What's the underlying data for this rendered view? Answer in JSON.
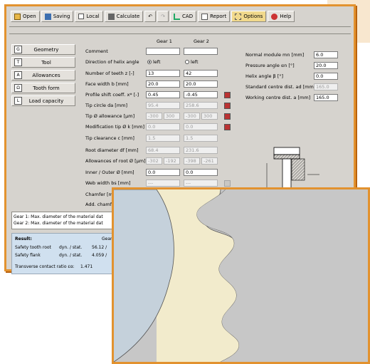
{
  "toolbar": {
    "open": "Open",
    "saving": "Saving",
    "local": "Local",
    "calculate": "Calculate",
    "cad": "CAD",
    "report": "Report",
    "options": "Options",
    "help": "Help"
  },
  "sidebar": [
    {
      "label": "Geometry",
      "icon": "G"
    },
    {
      "label": "Tool",
      "icon": "T"
    },
    {
      "label": "Allowances",
      "icon": "A"
    },
    {
      "label": "Tooth form",
      "icon": "Ω"
    },
    {
      "label": "Load capacity",
      "icon": "L"
    }
  ],
  "columns": {
    "gear1": "Gear 1",
    "gear2": "Gear 2"
  },
  "rows": [
    {
      "label": "Comment",
      "g1": "",
      "g2": ""
    },
    {
      "label": "Direction of helix angle",
      "g1": "left",
      "g2": "left"
    },
    {
      "label": "Number of teeth z [-]",
      "g1": "13",
      "g2": "42"
    },
    {
      "label": "Face width b [mm]",
      "g1": "20.0",
      "g2": "20.0"
    },
    {
      "label": "Profile shift coeff. x* [-]",
      "g1": "0.45",
      "g2": "-0.45"
    },
    {
      "label": "Tip circle da [mm]",
      "g1": "95.4",
      "g2": "258.6"
    },
    {
      "label": "Tip Ø allowance [µm]",
      "g1a": "-300",
      "g1b": "300",
      "g2a": "-300",
      "g2b": "300"
    },
    {
      "label": "Modification tip Ø k [mm]",
      "g1": "0.0",
      "g2": "0.0"
    },
    {
      "label": "Tip clearance c [mm]",
      "g1": "1.5",
      "g2": "1.5"
    },
    {
      "label": "Root diameter df [mm]",
      "g1": "68.4",
      "g2": "231.6"
    },
    {
      "label": "Allowances of root Ø [µm]",
      "g1a": "-302",
      "g1b": "-192",
      "g2a": "-398",
      "g2b": "-261"
    },
    {
      "label": "Inner / Outer Ø [mm]",
      "g1": "0.0",
      "g2": "0.0"
    },
    {
      "label": "Web width bs [mm]",
      "g1": "---",
      "g2": "---"
    },
    {
      "label": "Chamfer [mm]",
      "g1": "",
      "g2": ""
    },
    {
      "label": "Add. chamfe",
      "g1": "",
      "g2": ""
    }
  ],
  "right_params": [
    {
      "label": "Normal module mn [mm]",
      "value": "6.0"
    },
    {
      "label": "Pressure angle αn [°]",
      "value": "20.0"
    },
    {
      "label": "Helix angle β [°]",
      "value": "0.0"
    },
    {
      "label": "Standard centre dist. ad [mm]",
      "value": "165.0"
    },
    {
      "label": "Working centre dist. a [mm]",
      "value": "165.0"
    }
  ],
  "messages": [
    "Gear 1: Max. diameter of the material dat",
    "Gear 2: Max. diameter of the material dat"
  ],
  "result": {
    "title": "Result:",
    "col": "Gear",
    "rows": [
      {
        "label": "Safety tooth root",
        "mode": "dyn. / stat.",
        "value": "56.12 /"
      },
      {
        "label": "Safety flank",
        "mode": "dyn. / stat.",
        "value": "4.059 /"
      }
    ],
    "ratio_label": "Transverse contact ratio εα:",
    "ratio_value": "1.471"
  },
  "colors": {
    "accent": "#e2922f",
    "gear_left": "#c5d1db",
    "gear_mid": "#f2ebcc",
    "gear_right": "#c7c7c7"
  }
}
